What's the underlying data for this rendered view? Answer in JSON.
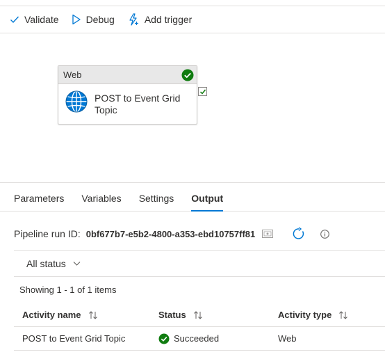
{
  "toolbar": {
    "validate_label": "Validate",
    "debug_label": "Debug",
    "add_trigger_label": "Add trigger"
  },
  "activity": {
    "type": "Web",
    "name": "POST to Event Grid Topic",
    "status_icon": "check-circle-icon",
    "icon": "globe-icon"
  },
  "tabs": [
    {
      "label": "Parameters",
      "active": false
    },
    {
      "label": "Variables",
      "active": false
    },
    {
      "label": "Settings",
      "active": false
    },
    {
      "label": "Output",
      "active": true
    }
  ],
  "output": {
    "run_id_label": "Pipeline run ID:",
    "run_id_value": "0bf677b7-e5b2-4800-a353-ebd10757ff81",
    "filter_label": "All status",
    "count_text": "Showing 1 - 1 of 1 items",
    "columns": [
      "Activity name",
      "Status",
      "Activity type"
    ],
    "rows": [
      {
        "name": "POST to Event Grid Topic",
        "status": "Succeeded",
        "type": "Web"
      }
    ]
  },
  "colors": {
    "accent": "#0078d4",
    "success": "#107c10",
    "border": "#e1dfdd"
  }
}
